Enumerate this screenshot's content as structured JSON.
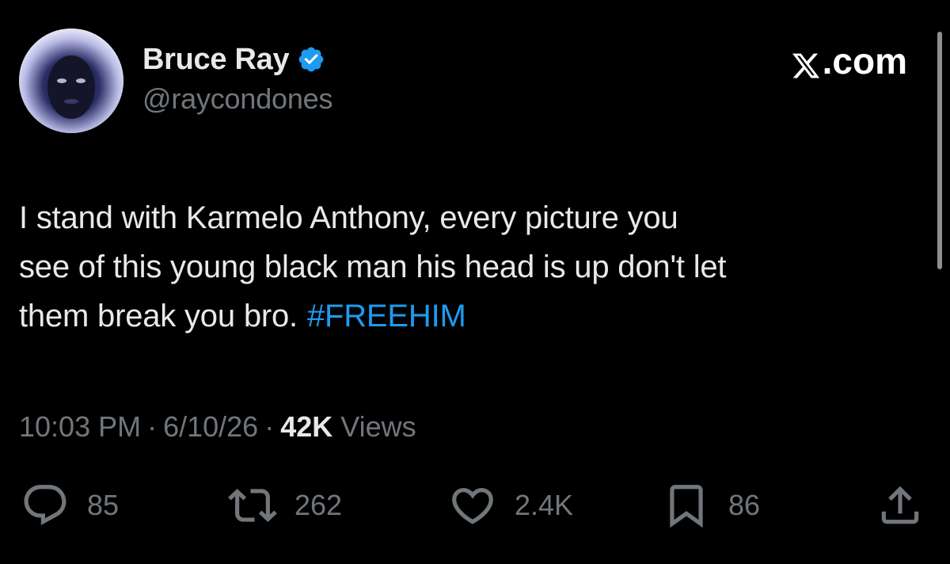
{
  "author": {
    "display_name": "Bruce Ray",
    "handle": "@raycondones",
    "verified": true,
    "avatar": "profile-photo"
  },
  "brand": {
    "label": ".com",
    "logo_icon": "x-logo-icon"
  },
  "tweet": {
    "text_line1": "I stand with Karmelo Anthony, every picture you",
    "text_line2": "see of this young black man his head is up don't let",
    "text_line3": "them break you bro.",
    "hashtag": "#FREEHIM"
  },
  "meta": {
    "time": "10:03 PM",
    "date": "6/10/26",
    "views_count": "42K",
    "views_label": "Views",
    "separator": "·"
  },
  "actions": {
    "replies": "85",
    "reposts": "262",
    "likes": "2.4K",
    "bookmarks": "86"
  },
  "colors": {
    "background": "#000000",
    "text": "#e7e9ea",
    "muted": "#71767b",
    "accent": "#1d9bf0"
  }
}
